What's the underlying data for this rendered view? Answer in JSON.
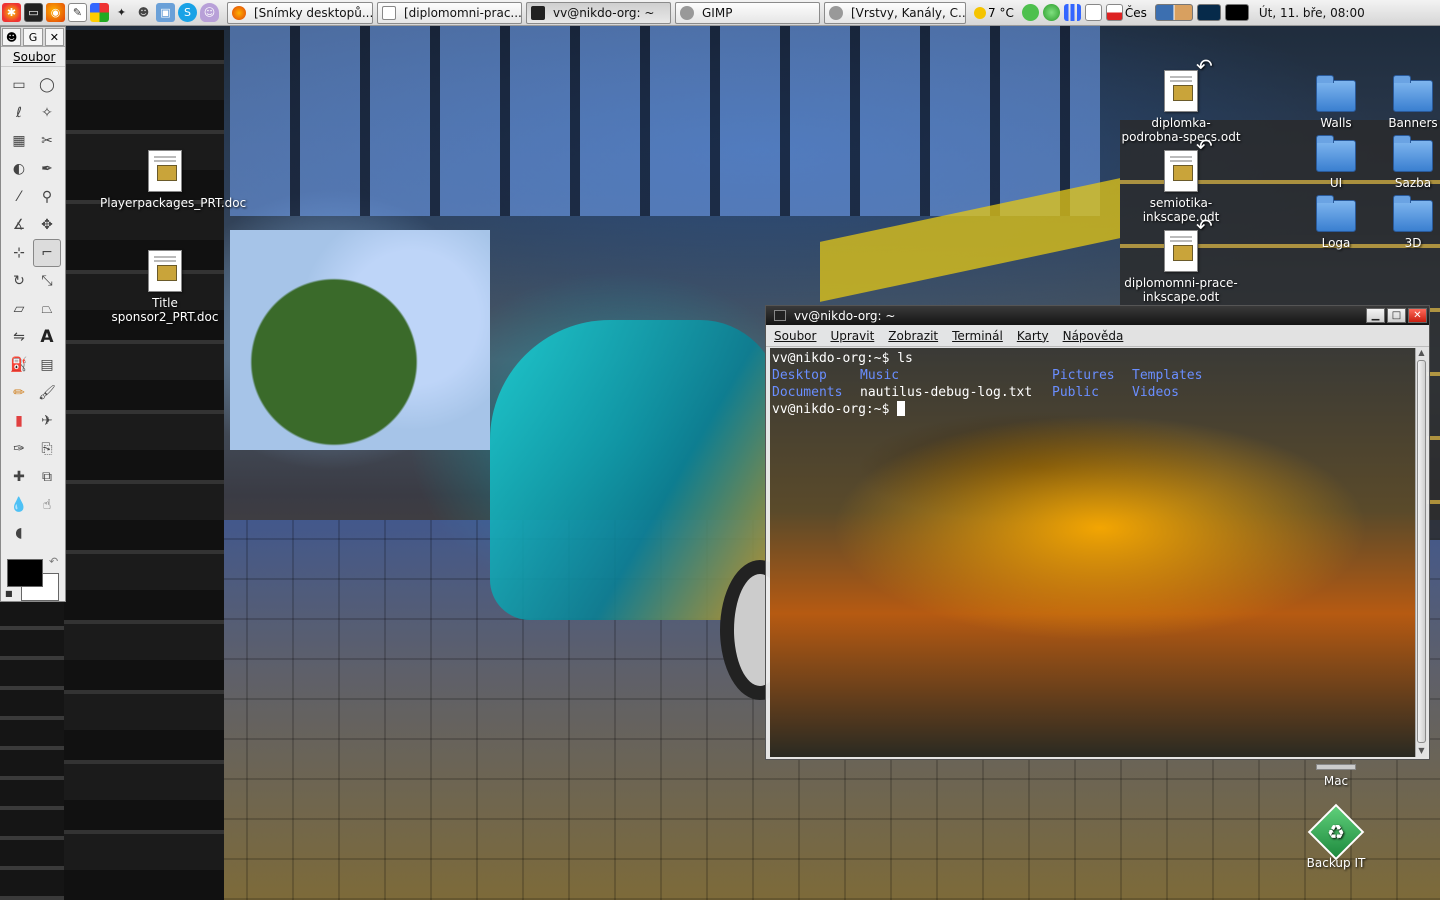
{
  "panel": {
    "launchers": [
      "menu-icon",
      "terminal-icon",
      "firefox-icon",
      "text-editor-icon",
      "windows-icon",
      "settings-icon",
      "gimp-icon",
      "image-viewer-icon",
      "skype-icon",
      "pidgin-icon"
    ],
    "tasks": [
      {
        "label": "[Snímky desktopů...",
        "icon": "firefox-icon"
      },
      {
        "label": "[diplomomni-prac...",
        "icon": "document-icon"
      },
      {
        "label": "vv@nikdo-org: ~",
        "icon": "terminal-icon"
      },
      {
        "label": "GIMP",
        "icon": "gimp-icon"
      },
      {
        "label": "[Vrstvy, Kanály, C...",
        "icon": "gimp-icon"
      }
    ],
    "weather": "7 °C",
    "keyboard_layout": "Čes",
    "clock": "Út, 11. bře, 08:00"
  },
  "gimp": {
    "tab_label": "G",
    "menu": "Soubor",
    "tools": [
      "rect-select-icon",
      "ellipse-select-icon",
      "lasso-icon",
      "fuzzy-select-icon",
      "color-select-icon",
      "scissors-icon",
      "foreground-select-icon",
      "paths-icon",
      "color-picker-icon",
      "zoom-icon",
      "measure-icon",
      "move-icon",
      "align-icon",
      "crop-icon",
      "rotate-icon",
      "scale-icon",
      "shear-icon",
      "perspective-icon",
      "flip-icon",
      "text-icon",
      "bucket-fill-icon",
      "blend-icon",
      "pencil-icon",
      "paintbrush-icon",
      "eraser-icon",
      "airbrush-icon",
      "ink-icon",
      "clone-icon",
      "heal-icon",
      "perspective-clone-icon",
      "blur-icon",
      "smudge-icon",
      "dodge-burn-icon"
    ],
    "selected_tool_index": 13,
    "fg_color": "#000000",
    "bg_color": "#ffffff"
  },
  "desktop": {
    "left_icons": [
      {
        "label": "Playerpackages_PRT.doc"
      },
      {
        "label": "Title sponsor2_PRT.doc"
      }
    ],
    "odt_icons": [
      {
        "label": "diplomka-podrobna-specs.odt"
      },
      {
        "label": "semiotika-inkscape.odt"
      },
      {
        "label": "diplomomni-prace-inkscape.odt"
      }
    ],
    "folders": [
      {
        "label": "Walls"
      },
      {
        "label": "Banners"
      },
      {
        "label": "UI"
      },
      {
        "label": "Sazba"
      },
      {
        "label": "Loga"
      },
      {
        "label": "3D"
      }
    ],
    "bottom_icons": [
      {
        "label": "Mac"
      },
      {
        "label": "Backup IT"
      }
    ]
  },
  "terminal": {
    "title": "vv@nikdo-org: ~",
    "menu": [
      "Soubor",
      "Upravit",
      "Zobrazit",
      "Terminál",
      "Karty",
      "Nápověda"
    ],
    "prompt1": "vv@nikdo-org:~$ ls",
    "ls_row1": [
      "Desktop",
      "Music",
      "Pictures",
      "Templates"
    ],
    "ls_row2_dir": "Documents",
    "ls_row2_file": "nautilus-debug-log.txt",
    "ls_row2_dirs2": [
      "Public",
      "Videos"
    ],
    "prompt2": "vv@nikdo-org:~$ ",
    "dir_color": "#6a8eff"
  }
}
